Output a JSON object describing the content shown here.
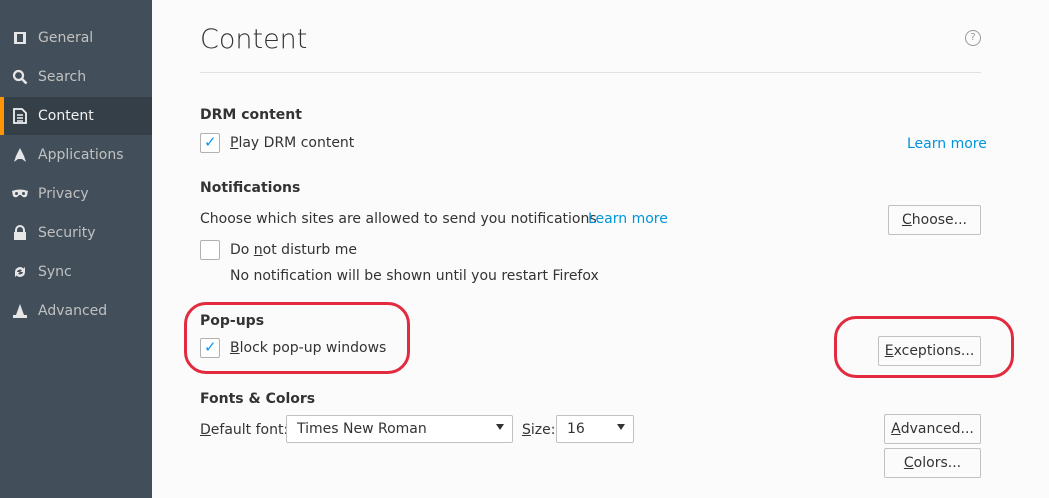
{
  "sidebar": {
    "items": [
      {
        "label": "General",
        "icon": "general-icon"
      },
      {
        "label": "Search",
        "icon": "search-icon"
      },
      {
        "label": "Content",
        "icon": "content-icon",
        "active": true
      },
      {
        "label": "Applications",
        "icon": "applications-icon"
      },
      {
        "label": "Privacy",
        "icon": "privacy-mask-icon"
      },
      {
        "label": "Security",
        "icon": "security-lock-icon"
      },
      {
        "label": "Sync",
        "icon": "sync-icon"
      },
      {
        "label": "Advanced",
        "icon": "advanced-wizard-icon"
      }
    ]
  },
  "main": {
    "title": "Content",
    "help": "?",
    "drm": {
      "heading": "DRM content",
      "checkbox_label": "Play DRM content",
      "learn_more": "Learn more"
    },
    "notifications": {
      "heading": "Notifications",
      "description": "Choose which sites are allowed to send you notifications",
      "learn_more": "Learn more",
      "choose_button": "Choose...",
      "dnd_label": "Do not disturb me",
      "dnd_note": "No notification will be shown until you restart Firefox"
    },
    "popups": {
      "heading": "Pop-ups",
      "checkbox_label": "Block pop-up windows",
      "exceptions_button": "Exceptions..."
    },
    "fonts": {
      "heading": "Fonts & Colors",
      "default_font_label": "Default font:",
      "default_font_value": "Times New Roman",
      "size_label": "Size:",
      "size_value": "16",
      "advanced_button": "Advanced...",
      "colors_button": "Colors..."
    }
  },
  "colors": {
    "sidebar": "#424f5a",
    "accent": "#ff9500",
    "link": "#0095dd",
    "annotation": "#e22b3f"
  }
}
